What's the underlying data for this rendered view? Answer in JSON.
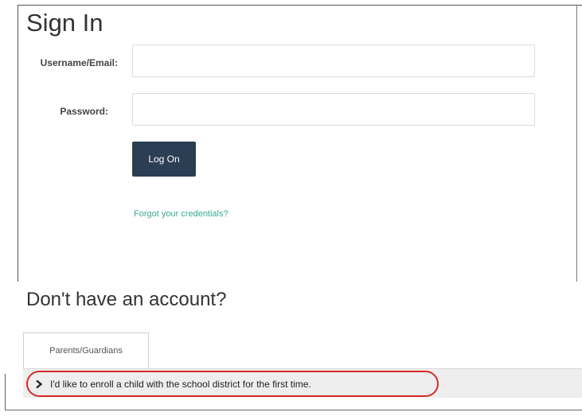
{
  "signin": {
    "title": "Sign In",
    "username_label": "Username/Email:",
    "username_value": "",
    "password_label": "Password:",
    "password_value": "",
    "logon_label": "Log On",
    "forgot_label": "Forgot your credentials?"
  },
  "signup": {
    "title": "Don't have an account?",
    "tabs": [
      {
        "label": "Parents/Guardians"
      }
    ],
    "items": [
      {
        "label": "I'd like to enroll a child with the school district for the first time.",
        "icon": "chevron-right-icon"
      }
    ]
  },
  "colors": {
    "button_bg": "#2b3e53",
    "link": "#3aa88e",
    "highlight": "#d62b2b"
  }
}
